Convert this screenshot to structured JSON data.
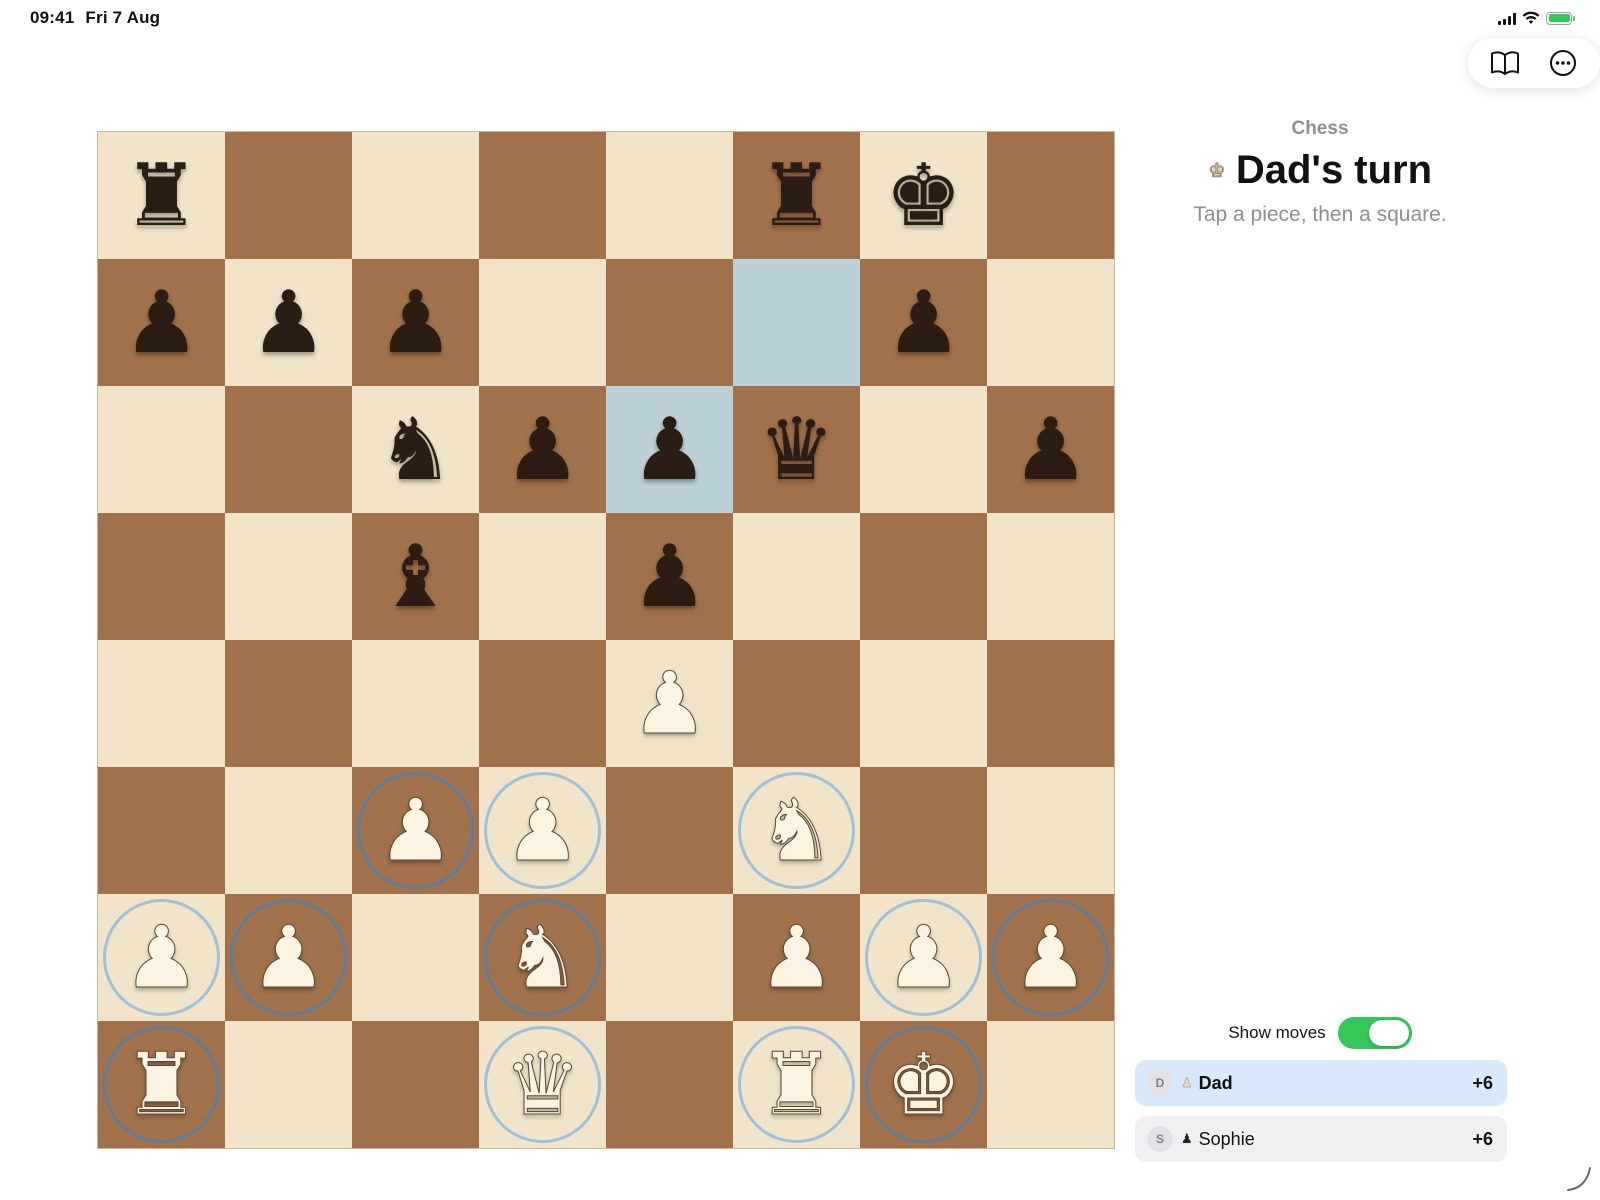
{
  "status_bar": {
    "time": "09:41",
    "date": "Fri 7 Aug"
  },
  "toolbar": {
    "rules_icon": "book-icon",
    "more_icon": "ellipsis-circle-icon"
  },
  "header": {
    "game_name": "Chess",
    "turn_title": "Dad's turn",
    "hint": "Tap a piece, then a square."
  },
  "colors": {
    "light_square": "#f1e4c8",
    "dark_square": "#a0714a",
    "highlight_square": "#bcd0d8",
    "move_ring_light": "#9fc0d8",
    "move_ring_dark": "#5e7d9a",
    "toggle_on": "#34c759",
    "active_player_bg": "#d7e9fb"
  },
  "board": {
    "ranks": [
      [
        "bR",
        "",
        "",
        "",
        "",
        "bR",
        "bK",
        ""
      ],
      [
        "bP",
        "bP",
        "bP",
        "",
        "",
        "",
        "bP",
        ""
      ],
      [
        "",
        "",
        "bN",
        "bP",
        "bP",
        "bQ",
        "",
        "bP"
      ],
      [
        "",
        "",
        "bB",
        "",
        "bP",
        "",
        "",
        ""
      ],
      [
        "",
        "",
        "",
        "",
        "wP",
        "",
        "",
        ""
      ],
      [
        "",
        "",
        "wP",
        "wP",
        "",
        "wN",
        "",
        ""
      ],
      [
        "wP",
        "wP",
        "",
        "wN",
        "",
        "wP",
        "wP",
        "wP"
      ],
      [
        "wR",
        "",
        "",
        "wQ",
        "",
        "wR",
        "wK",
        ""
      ]
    ],
    "highlighted_squares": [
      "f7",
      "e6"
    ],
    "movable_squares": [
      "c3",
      "d3",
      "f3",
      "a2",
      "b2",
      "d2",
      "g2",
      "h2",
      "a1",
      "d1",
      "f1",
      "g1"
    ]
  },
  "controls": {
    "show_moves_label": "Show moves",
    "show_moves_on": true
  },
  "players": [
    {
      "initial": "D",
      "piece": "white-pawn-icon",
      "name": "Dad",
      "score": "+6",
      "active": true
    },
    {
      "initial": "S",
      "piece": "black-pawn-icon",
      "name": "Sophie",
      "score": "+6",
      "active": false
    }
  ]
}
